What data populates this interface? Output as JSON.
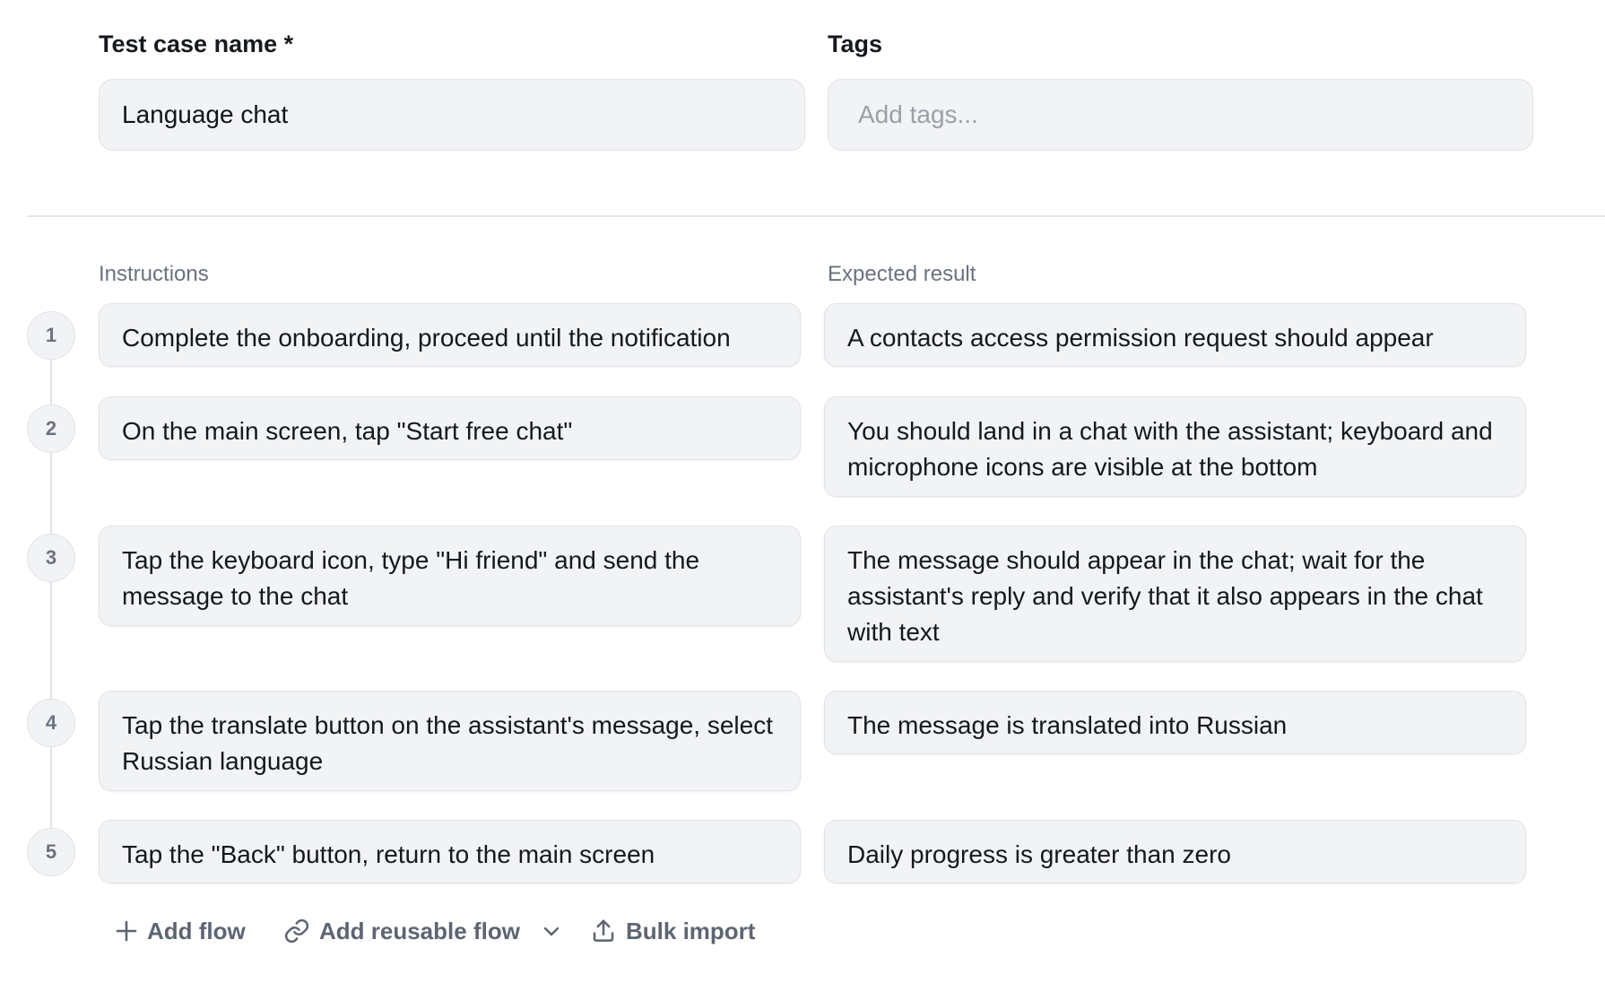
{
  "form": {
    "name_label": "Test case name *",
    "name_value": "Language chat",
    "tags_label": "Tags",
    "tags_placeholder": "Add tags..."
  },
  "steps_table": {
    "instructions_header": "Instructions",
    "expected_header": "Expected result",
    "steps": [
      {
        "number": "1",
        "instruction": "Complete the onboarding, proceed until the notification",
        "expected": "A contacts access permission request should appear"
      },
      {
        "number": "2",
        "instruction": "On the main screen, tap \"Start free chat\"",
        "expected": "You should land in a chat with the assistant; keyboard and microphone icons are visible at the bottom"
      },
      {
        "number": "3",
        "instruction": "Tap the keyboard icon, type \"Hi friend\" and send the message to the chat",
        "expected": "The message should appear in the chat; wait for the assistant's reply and verify that it also appears in the chat with text"
      },
      {
        "number": "4",
        "instruction": "Tap the translate button on the assistant's message, select Russian language",
        "expected": "The message is translated into Russian"
      },
      {
        "number": "5",
        "instruction": "Tap the \"Back\" button, return to the main screen",
        "expected": "Daily progress is greater than zero"
      }
    ]
  },
  "actions": {
    "add_flow": "Add flow",
    "add_reusable_flow": "Add reusable flow",
    "bulk_import": "Bulk import"
  },
  "icons": {
    "add_flow": "plus-icon",
    "add_reusable_flow": "link-icon",
    "reusable_dropdown": "chevron-down-icon",
    "bulk_import": "upload-icon"
  }
}
